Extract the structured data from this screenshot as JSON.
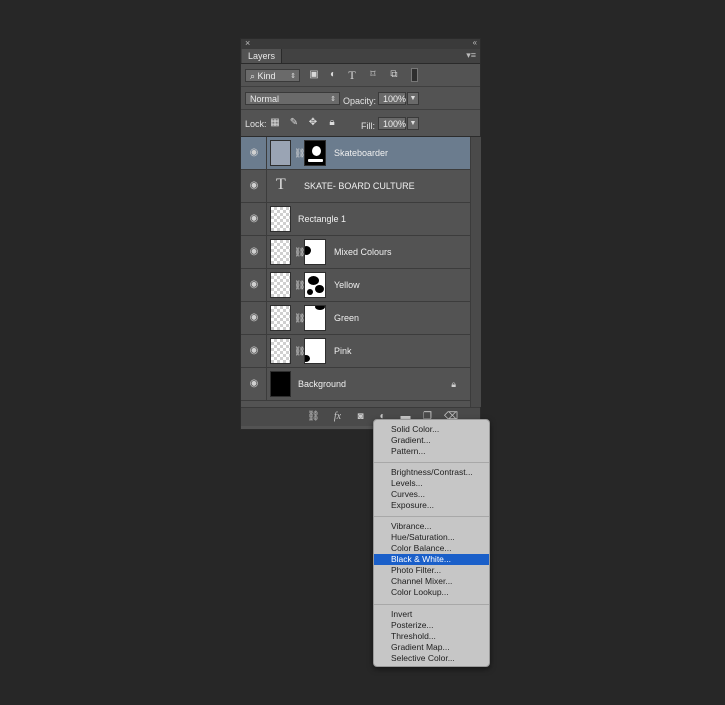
{
  "panel": {
    "close_glyph": "×",
    "collapse_glyph": "‹‹",
    "tab_label": "Layers",
    "tab_menu_glyph": "▾≡"
  },
  "filter_row": {
    "kind_label": "Kind",
    "icons": [
      "image-filter-icon",
      "adjustment-filter-icon",
      "type-filter-icon",
      "shape-filter-icon",
      "smart-object-filter-icon",
      "filter-toggle-icon"
    ]
  },
  "blend_row": {
    "mode": "Normal",
    "opacity_label": "Opacity:",
    "opacity_value": "100%"
  },
  "lock_row": {
    "lock_label": "Lock:",
    "fill_label": "Fill:",
    "fill_value": "100%"
  },
  "layers": [
    {
      "name": "Skateboarder",
      "selected": true,
      "type": "masked-photo"
    },
    {
      "name": "SKATE- BOARD CULTURE",
      "type": "text"
    },
    {
      "name": "Rectangle 1",
      "type": "shape"
    },
    {
      "name": "Mixed Colours",
      "type": "masked"
    },
    {
      "name": "Yellow",
      "type": "masked"
    },
    {
      "name": "Green",
      "type": "masked"
    },
    {
      "name": "Pink",
      "type": "masked"
    },
    {
      "name": "Background",
      "type": "background",
      "locked": true
    }
  ],
  "footer_icons": [
    "link-layers-icon",
    "fx-icon",
    "add-mask-icon",
    "new-adjustment-layer-icon",
    "new-group-icon",
    "new-layer-icon",
    "trash-icon"
  ],
  "fx_label": "fx",
  "menu": {
    "groups": [
      [
        "Solid Color...",
        "Gradient...",
        "Pattern..."
      ],
      [
        "Brightness/Contrast...",
        "Levels...",
        "Curves...",
        "Exposure..."
      ],
      [
        "Vibrance...",
        "Hue/Saturation...",
        "Color Balance...",
        "Black & White...",
        "Photo Filter...",
        "Channel Mixer...",
        "Color Lookup..."
      ],
      [
        "Invert",
        "Posterize...",
        "Threshold...",
        "Gradient Map...",
        "Selective Color..."
      ]
    ],
    "highlighted": "Black & White..."
  },
  "colors": {
    "selection": "#6b7c8e",
    "menu_highlight": "#1a5fc9"
  }
}
